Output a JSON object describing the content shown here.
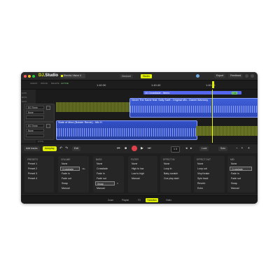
{
  "colors": {
    "accent": "#e0f000",
    "clip_blue": "#3f5fd8",
    "record": "#e0404a",
    "waveform_olive": "#7f8a2a"
  },
  "app": {
    "logo_prefix": "DJ",
    "logo_suffix": ".Studio",
    "project_name": "Electric Vision 4"
  },
  "header": {
    "mode_tabs": [
      "Decknet",
      "Studio"
    ],
    "active_mode": "Studio",
    "right_buttons": [
      "Export",
      "Feedback"
    ]
  },
  "ruler": {
    "labels": [
      "CHECK",
      "SPACE",
      "DELETE",
      "ACTIVE"
    ],
    "ticks": [
      "1:40:30",
      "1:40:40",
      "1:40:50"
    ]
  },
  "tracks": {
    "side_labels": [
      "AUTO",
      "MUTE",
      "SOLO"
    ],
    "deck1": {
      "effect": "EQ Three",
      "param": "None"
    },
    "deck2": {
      "effect": "EQ Three",
      "param": "None"
    },
    "clip_top": "10 Crossfade - Items",
    "clip_top_badge": "1:00",
    "clip_main": "Never The Same feat. Sally Sarft - Original Mix - Daniel Wanrooy",
    "clip_low": "State of Mind (Bolster Remix) - Mix H",
    "lane_label": "UTTS"
  },
  "transport": {
    "left_buttons": [
      "Add tracks",
      "Autoplay"
    ],
    "edit_label": "Edit",
    "counter": "1",
    "counter_total": "3",
    "right_labels": [
      "Lock",
      "Solo"
    ]
  },
  "panel": {
    "columns": [
      {
        "title": "PRESETS",
        "items": [
          "Preset 1",
          "Preset 2",
          "Preset 3",
          "Preset 4"
        ],
        "selected": -1
      },
      {
        "title": "VOLUME",
        "items": [
          "None",
          "Crossfade",
          "Fade in",
          "Fade out",
          "Swap",
          "Manual"
        ],
        "selected": 1,
        "badge": "Idle"
      },
      {
        "title": "BASS",
        "items": [
          "None",
          "Crossfade",
          "Fade in",
          "Fade out",
          "Swap",
          "Manual"
        ],
        "selected": 4,
        "badge": "0"
      },
      {
        "title": "FILTER",
        "items": [
          "None",
          "High to low",
          "Low to high",
          "Manual"
        ],
        "selected": -1
      },
      {
        "title": "EFFECT IN",
        "items": [
          "None",
          "Loop in",
          "Baby scratch",
          "Cue play start"
        ],
        "selected": -1
      },
      {
        "title": "EFFECT OUT",
        "items": [
          "None",
          "Loop out",
          "Vinyl brake",
          "Spin back",
          "Reverb",
          "Echo"
        ],
        "selected": -1
      },
      {
        "title": "MID",
        "items": [
          "None",
          "Crossfade",
          "Fade in",
          "Fade out",
          "Swap",
          "Manual"
        ],
        "selected": 1
      }
    ]
  },
  "footer": {
    "tabs": [
      "Zoom",
      "Playlist",
      "FX",
      "Transition",
      "Video"
    ],
    "active": "Transition"
  }
}
